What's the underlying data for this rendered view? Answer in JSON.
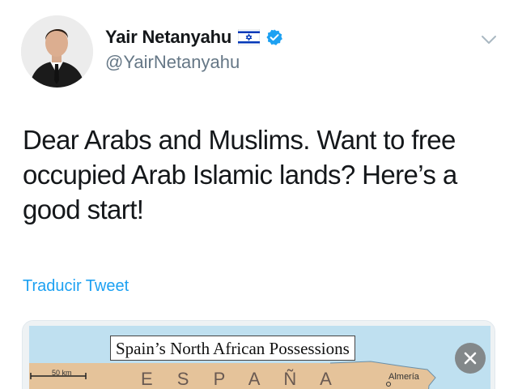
{
  "tweet": {
    "author": {
      "display_name": "Yair Netanyahu",
      "handle": "@YairNetanyahu",
      "verified": true,
      "flag_icon": "israel-flag-icon",
      "avatar_icon": "profile-photo"
    },
    "text_lines": [
      "Dear Arabs and Muslims. Want to free",
      "occupied Arab Islamic lands? Here’s a",
      "good start!"
    ],
    "translate_label": "Traducir Tweet",
    "menu_icon": "chevron-down-icon",
    "media": {
      "map_title": "Spain’s North African Possessions",
      "scale_label": "50 km",
      "country_label": "E S P A Ñ A",
      "city_label": "Almería",
      "close_icon": "close-icon"
    }
  },
  "colors": {
    "link_blue": "#1da1f2",
    "verified_blue": "#1da1f2",
    "text": "#14171a",
    "secondary_text": "#657786",
    "map_land": "#e5c39a",
    "map_sea": "#bfe0f0"
  }
}
